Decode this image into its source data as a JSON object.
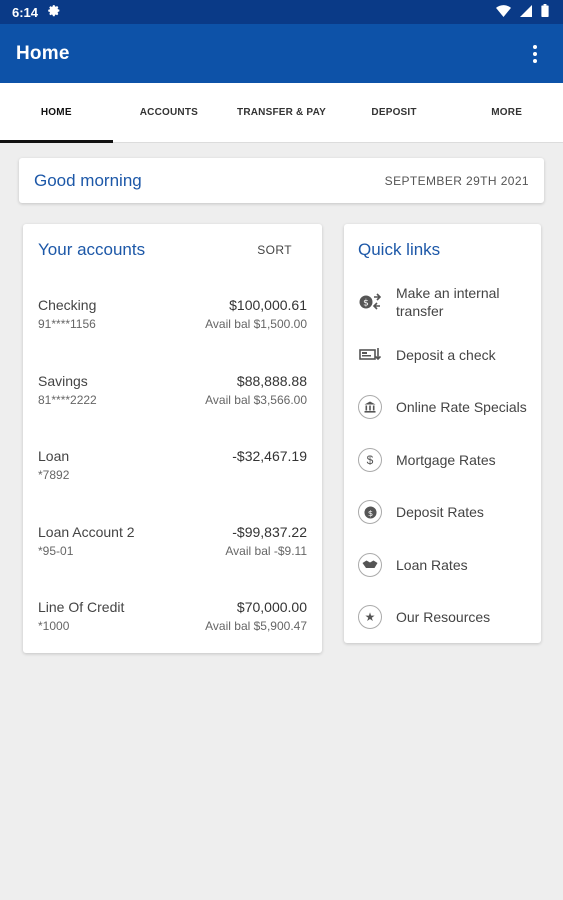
{
  "status_bar": {
    "time": "6:14"
  },
  "app_bar": {
    "title": "Home"
  },
  "tabs": [
    {
      "label": "HOME",
      "active": true
    },
    {
      "label": "ACCOUNTS",
      "active": false
    },
    {
      "label": "TRANSFER & PAY",
      "active": false
    },
    {
      "label": "DEPOSIT",
      "active": false
    },
    {
      "label": "MORE",
      "active": false
    }
  ],
  "greeting": {
    "text": "Good morning",
    "date": "SEPTEMBER 29TH 2021"
  },
  "accounts": {
    "title": "Your accounts",
    "sort_label": "SORT",
    "items": [
      {
        "name": "Checking",
        "number": "91****1156",
        "balance": "$100,000.61",
        "avail": "Avail bal $1,500.00"
      },
      {
        "name": "Savings",
        "number": "81****2222",
        "balance": "$88,888.88",
        "avail": "Avail bal $3,566.00"
      },
      {
        "name": "Loan",
        "number": "*7892",
        "balance": "-$32,467.19",
        "avail": ""
      },
      {
        "name": "Loan Account 2",
        "number": "*95-01",
        "balance": "-$99,837.22",
        "avail": "Avail bal -$9.11"
      },
      {
        "name": "Line Of Credit",
        "number": "*1000",
        "balance": "$70,000.00",
        "avail": "Avail bal $5,900.47"
      }
    ]
  },
  "quick_links": {
    "title": "Quick links",
    "items": [
      {
        "label": "Make an internal transfer",
        "icon": "transfer-icon"
      },
      {
        "label": "Deposit a check",
        "icon": "check-deposit-icon"
      },
      {
        "label": "Online Rate Specials",
        "icon": "bank-icon"
      },
      {
        "label": "Mortgage Rates",
        "icon": "dollar-icon"
      },
      {
        "label": "Deposit Rates",
        "icon": "coin-icon"
      },
      {
        "label": "Loan Rates",
        "icon": "handshake-icon"
      },
      {
        "label": "Our Resources",
        "icon": "star-icon"
      }
    ]
  },
  "colors": {
    "status_bar": "#0a3a87",
    "app_bar": "#0d52a8",
    "accent_text": "#1d58a8",
    "background": "#eeeeee"
  }
}
